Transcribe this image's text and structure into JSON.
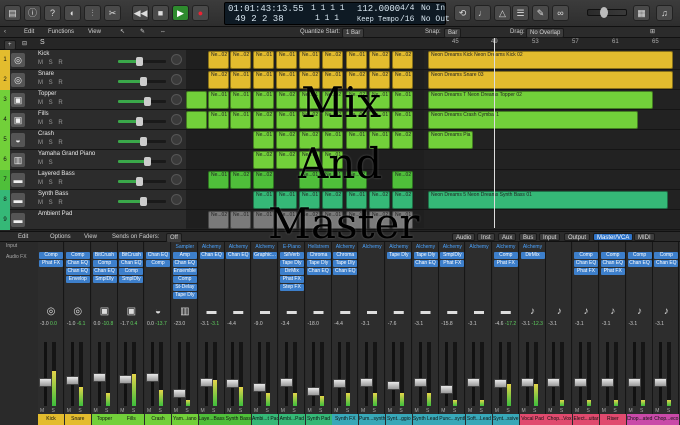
{
  "control_bar": {
    "lcd": {
      "time": "01:01:43:13.55",
      "bars_top": "1  1  1  1",
      "bars": "49  2  2  38",
      "bars2": "1  1  1",
      "tempo": "112.0000",
      "tempo_mode": "Keep Tempo",
      "sig_top": "4/4",
      "sig_bottom": "/16",
      "in": "No In",
      "out": "No Out"
    },
    "quantize_start_label": "Quantize Start:",
    "quantize_value": "1 Bar"
  },
  "track_header_bar": {
    "edit": "Edit",
    "functions": "Functions",
    "view": "View",
    "snap_label": "Snap:",
    "snap_value": "Bar",
    "drag_label": "Drag:",
    "drag_value": "No Overlap"
  },
  "ruler": [
    "45",
    "49",
    "53",
    "57",
    "61",
    "65"
  ],
  "tracks": [
    {
      "num": "1",
      "name": "Kick",
      "ms": "M S R",
      "color": "#e3bc2e",
      "icon": "drum"
    },
    {
      "num": "2",
      "name": "Snare",
      "ms": "M S R",
      "color": "#e3bc2e",
      "icon": "drum"
    },
    {
      "num": "3",
      "name": "Topper",
      "ms": "M S R",
      "color": "#72d03a",
      "icon": "speaker"
    },
    {
      "num": "4",
      "name": "Fills",
      "ms": "M S R",
      "color": "#72d03a",
      "icon": "speaker"
    },
    {
      "num": "5",
      "name": "Crash",
      "ms": "M S R",
      "color": "#72d03a",
      "icon": "cymbal"
    },
    {
      "num": "6",
      "name": "Yamaha Grand Piano",
      "ms": "M S",
      "color": "#72d03a",
      "icon": "piano"
    },
    {
      "num": "7",
      "name": "Layered Bass",
      "ms": "M S R",
      "color": "#4fbf3a",
      "icon": "keyboard"
    },
    {
      "num": "8",
      "name": "Synth Bass",
      "ms": "M S R",
      "color": "#35b877",
      "icon": "keyboard"
    },
    {
      "num": "9",
      "name": "Ambient Pad",
      "ms": "",
      "color": "#35b877",
      "icon": "keyboard"
    }
  ],
  "regions_right": [
    "Neon Dreams Kick  Neon Dreams Kick 02",
    "Neon Dreams Snare 03",
    "Neon Dreams T  Neon Dreams Topper 02",
    "Neon Dreams Crash Cymbal 1",
    "Neon Dreams Pia",
    "Neon Dreams 5  Neon Dreams Synth Bass 01"
  ],
  "region_short": [
    "Ne...02",
    "Ne...02",
    "Ne...01",
    "Ne...01",
    "Ne...01",
    "Ne...02",
    "Ne...01"
  ],
  "overlay": {
    "line1": "Mix",
    "line2": "And",
    "line3": "Master"
  },
  "mixer_bar": {
    "edit": "Edit",
    "options": "Options",
    "view": "View",
    "sends": "Sends on Faders:",
    "sends_value": "Off",
    "tabs": [
      "Audio",
      "Inst",
      "Aux",
      "Bus",
      "Input",
      "Output",
      "Master/VCA",
      "MIDI"
    ],
    "active_tab": "Master/VCA"
  },
  "mixer_labels": {
    "input": "Input",
    "audio_fx": "Audio FX"
  },
  "strips": [
    {
      "name": "Kick",
      "color": "#e3bc2e",
      "in": "",
      "fx": [
        "Comp",
        "Phat FX"
      ],
      "vol": "-3.0",
      "pk": "0.0",
      "meter": 0.55,
      "fader": 0.38
    },
    {
      "name": "Snare",
      "color": "#e3bc2e",
      "in": "",
      "fx": [
        "Comp",
        "Chan EQ",
        "Chan EQ",
        "Envelop"
      ],
      "vol": "-1.0",
      "pk": "-6.1",
      "meter": 0.3,
      "fader": 0.4
    },
    {
      "name": "Topper",
      "color": "#72d03a",
      "in": "",
      "fx": [
        "BitCrush",
        "Comp",
        "Chan EQ",
        "SmplDly"
      ],
      "vol": "0.0",
      "pk": "-10.8",
      "meter": 0.2,
      "fader": 0.45
    },
    {
      "name": "Fills",
      "color": "#72d03a",
      "in": "",
      "fx": [
        "BitCrush",
        "Chan EQ",
        "Comp",
        "SmplDly"
      ],
      "vol": "-1.7",
      "pk": "0.4",
      "meter": 0.5,
      "fader": 0.42
    },
    {
      "name": "Crash",
      "color": "#72d03a",
      "in": "",
      "fx": [
        "Chan EQ",
        "Comp"
      ],
      "vol": "0.0",
      "pk": "-13.7",
      "meter": 0.25,
      "fader": 0.45
    },
    {
      "name": "Yam...iano",
      "color": "#72d03a",
      "in": "Sampler",
      "fx": [
        "Amp",
        "Chan EQ",
        "Ensemble",
        "Comp",
        "St-Delay",
        "Tape Dly"
      ],
      "vol": "-23.0",
      "pk": "",
      "meter": 0.1,
      "fader": 0.2
    },
    {
      "name": "Laye...Bass",
      "color": "#4fbf3a",
      "in": "Alchemy",
      "fx": [
        "Chan EQ"
      ],
      "vol": "-3.1",
      "pk": "-3.1",
      "meter": 0.4,
      "fader": 0.38
    },
    {
      "name": "Synth Bass",
      "color": "#4fbf3a",
      "in": "Alchemy",
      "fx": [
        "Chan EQ"
      ],
      "vol": "-4.4",
      "pk": "",
      "meter": 0.3,
      "fader": 0.36
    },
    {
      "name": "Ambi...t Pad",
      "color": "#35b877",
      "in": "Alchemy",
      "fx": [
        "Graphic..."
      ],
      "vol": "-9.0",
      "pk": "",
      "meter": 0.2,
      "fader": 0.3
    },
    {
      "name": "Ambi...Pad",
      "color": "#35b877",
      "in": "E-Piano",
      "fx": [
        "SilVerb",
        "Tape Dly",
        "DirMix",
        "Phat FX",
        "Step FX"
      ],
      "vol": "-3.4",
      "pk": "",
      "meter": 0.2,
      "fader": 0.38
    },
    {
      "name": "Synth Pad",
      "color": "#35b877",
      "in": "Hellstrem",
      "fx": [
        "Chroma",
        "Tape Dly",
        "Chan EQ"
      ],
      "vol": "-18.0",
      "pk": "",
      "meter": 0.15,
      "fader": 0.24
    },
    {
      "name": "Synth FX",
      "color": "#38a8b8",
      "in": "Alchemy",
      "fx": [
        "Chroma",
        "Tape Dly",
        "Chan EQ"
      ],
      "vol": "-4.4",
      "pk": "",
      "meter": 0.2,
      "fader": 0.36
    },
    {
      "name": "Pum...synth",
      "color": "#38a8b8",
      "in": "Alchemy",
      "fx": [],
      "vol": "-3.1",
      "pk": "",
      "meter": 0.2,
      "fader": 0.38
    },
    {
      "name": "Synt...ggio",
      "color": "#38a8b8",
      "in": "Alchemy",
      "fx": [
        "Tape Dly"
      ],
      "vol": "-7.6",
      "pk": "",
      "meter": 0.2,
      "fader": 0.33
    },
    {
      "name": "Synth Lead",
      "color": "#38a8b8",
      "in": "Alchemy",
      "fx": [
        "Tape Dly",
        "Chan EQ"
      ],
      "vol": "-3.1",
      "pk": "",
      "meter": 0.2,
      "fader": 0.38
    },
    {
      "name": "Punc...synth",
      "color": "#38a8b8",
      "in": "Alchemy",
      "fx": [
        "SmplDly",
        "Phat FX"
      ],
      "vol": "-15.8",
      "pk": "",
      "meter": 0.1,
      "fader": 0.26
    },
    {
      "name": "Soft...Lead",
      "color": "#38a8b8",
      "in": "Alchemy",
      "fx": [],
      "vol": "-3.1",
      "pk": "",
      "meter": 0.1,
      "fader": 0.38
    },
    {
      "name": "Synt...ssive",
      "color": "#38a8b8",
      "in": "Alchemy",
      "fx": [
        "Comp",
        "Phat FX"
      ],
      "vol": "-4.6",
      "pk": "-17.2",
      "meter": 0.35,
      "fader": 0.36
    },
    {
      "name": "Vocal Pad",
      "color": "#e04a6e",
      "in": "Alchemy",
      "fx": [
        "DirMix"
      ],
      "vol": "-3.1",
      "pk": "-12.3",
      "meter": 0.35,
      "fader": 0.38
    },
    {
      "name": "Chop...Vox",
      "color": "#e04a6e",
      "in": "",
      "fx": [],
      "vol": "-3.1",
      "pk": "",
      "meter": 0.1,
      "fader": 0.38
    },
    {
      "name": "Elect...uitar",
      "color": "#e04a6e",
      "in": "",
      "fx": [
        "Comp",
        "Chan EQ",
        "Phat FX"
      ],
      "vol": "-3.1",
      "pk": "",
      "meter": 0.1,
      "fader": 0.38
    },
    {
      "name": "Riser",
      "color": "#e04a6e",
      "in": "",
      "fx": [
        "Comp",
        "Chan EQ",
        "Phat FX"
      ],
      "vol": "-3.1",
      "pk": "",
      "meter": 0.1,
      "fader": 0.38
    },
    {
      "name": "Chop...ated",
      "color": "#c94aa8",
      "in": "",
      "fx": [
        "Comp",
        "Chan EQ"
      ],
      "vol": "-3.1",
      "pk": "",
      "meter": 0.1,
      "fader": 0.38
    },
    {
      "name": "Chop...eco",
      "color": "#c94aa8",
      "in": "",
      "fx": [
        "Comp",
        "Chan EQ"
      ],
      "vol": "-3.1",
      "pk": "",
      "meter": 0.1,
      "fader": 0.38
    }
  ],
  "strip_ms": "M S"
}
